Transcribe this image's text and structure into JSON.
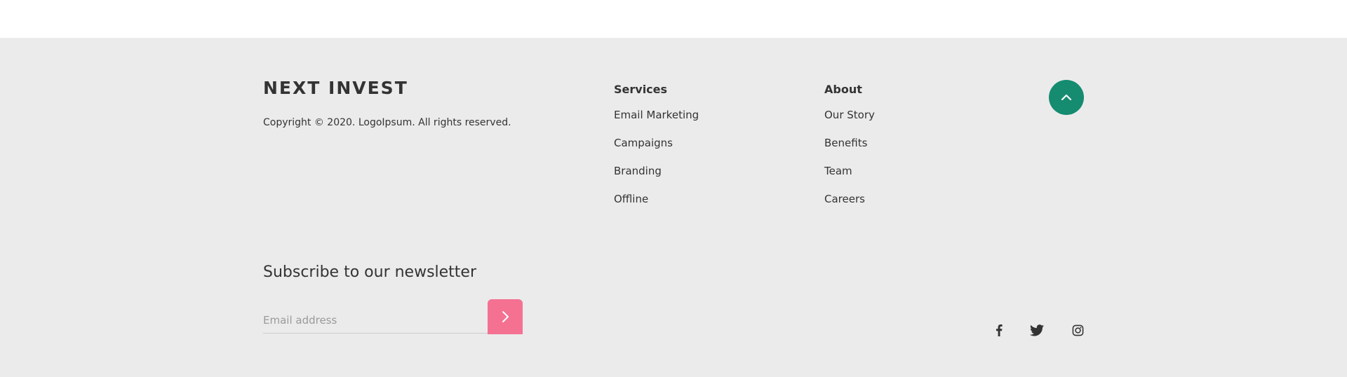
{
  "brand": {
    "name": "NEXT INVEST",
    "copyright": "Copyright © 2020. LogoIpsum. All rights reserved."
  },
  "services": {
    "heading": "Services",
    "links": [
      "Email Marketing",
      "Campaigns",
      "Branding",
      "Offline"
    ]
  },
  "about": {
    "heading": "About",
    "links": [
      "Our Story",
      "Benefits",
      "Team",
      "Careers"
    ]
  },
  "newsletter": {
    "title": "Subscribe to our newsletter",
    "placeholder": "Email address"
  },
  "social": [
    "facebook-icon",
    "twitter-icon",
    "instagram-icon"
  ],
  "colors": {
    "background": "#ebebeb",
    "scroll_top_button": "#158b70",
    "submit_button": "#f47192",
    "text": "#333333"
  },
  "icons": {
    "scroll_top": "chevron-up-icon",
    "submit": "chevron-right-icon"
  }
}
